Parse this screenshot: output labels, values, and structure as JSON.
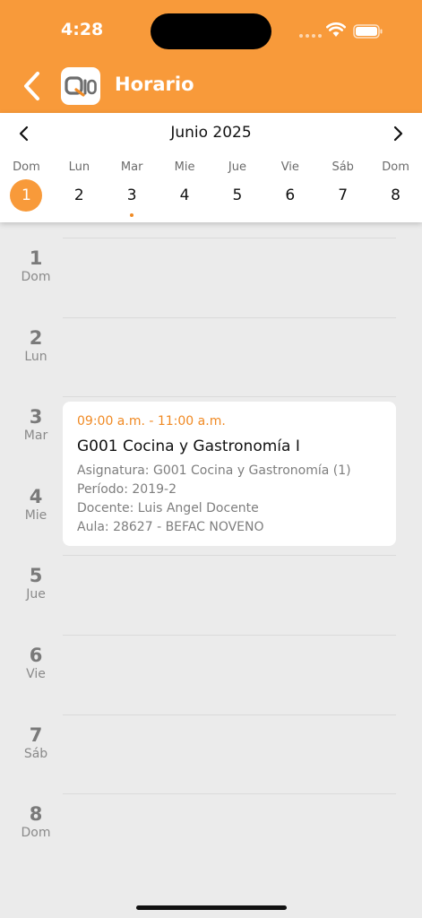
{
  "status_bar": {
    "time": "4:28"
  },
  "header": {
    "title": "Horario"
  },
  "calendar": {
    "month_label": "Junio 2025",
    "days": [
      {
        "name": "Dom",
        "num": "1",
        "selected": true,
        "has_event": false
      },
      {
        "name": "Lun",
        "num": "2",
        "selected": false,
        "has_event": false
      },
      {
        "name": "Mar",
        "num": "3",
        "selected": false,
        "has_event": true
      },
      {
        "name": "Mie",
        "num": "4",
        "selected": false,
        "has_event": false
      },
      {
        "name": "Jue",
        "num": "5",
        "selected": false,
        "has_event": false
      },
      {
        "name": "Vie",
        "num": "6",
        "selected": false,
        "has_event": false
      },
      {
        "name": "Sáb",
        "num": "7",
        "selected": false,
        "has_event": false
      },
      {
        "name": "Dom",
        "num": "8",
        "selected": false,
        "has_event": false
      }
    ]
  },
  "schedule": {
    "rows": [
      {
        "num": "1",
        "day": "Dom"
      },
      {
        "num": "2",
        "day": "Lun"
      },
      {
        "num": "3",
        "day": "Mar"
      },
      {
        "num": "4",
        "day": "Mie"
      },
      {
        "num": "5",
        "day": "Jue"
      },
      {
        "num": "6",
        "day": "Vie"
      },
      {
        "num": "7",
        "day": "Sáb"
      },
      {
        "num": "8",
        "day": "Dom"
      }
    ],
    "event": {
      "time": "09:00 a.m. - 11:00 a.m.",
      "title": "G001 Cocina y Gastronomía I",
      "details": [
        "Asignatura: G001 Cocina y Gastronomía (1)",
        "Período: 2019-2",
        "Docente: Luis Angel Docente",
        "Aula: 28627 - BEFAC NOVENO"
      ]
    }
  },
  "colors": {
    "accent": "#f89a3a",
    "event_time": "#f08a24",
    "background": "#ebebeb"
  },
  "icons": {
    "back": "chevron-left-icon",
    "prev": "chevron-left-icon",
    "next": "chevron-right-icon",
    "logo": "q10-logo"
  }
}
